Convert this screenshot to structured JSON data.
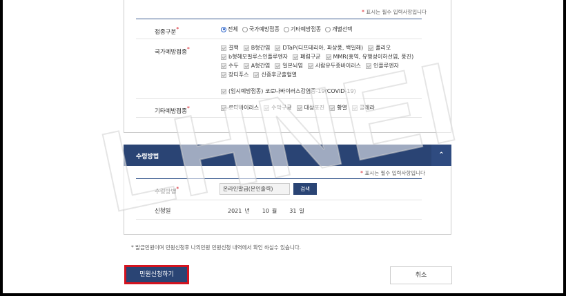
{
  "form_top": {
    "required_note": "표시는 필수 입력사항입니다",
    "vaccination_type": {
      "label": "접종구분",
      "options": [
        "전체",
        "국가예방접종",
        "기타예방접종",
        "개별선택"
      ],
      "selected": "전체"
    },
    "national": {
      "label": "국가예방접종",
      "rows": [
        [
          "결핵",
          "B형간염",
          "DTaP(디프테리아, 파상풍, 백일해)",
          "폴리오"
        ],
        [
          "b형헤모필루스인플루엔자",
          "폐렴구균",
          "MMR(홍역, 유행성이하선염, 풍진)"
        ],
        [
          "수두",
          "A형간염",
          "일본뇌염",
          "사람유두종바이러스",
          "인플루엔자"
        ],
        [
          "장티푸스",
          "신증후군출혈열"
        ]
      ],
      "covid": "(임시예방접종) 코로나바이러스감염증-19(COVID-19)"
    },
    "other": {
      "label": "기타예방접종",
      "items": [
        "로타바이러스",
        "수막구균",
        "대상포진",
        "황열",
        "콜레라"
      ]
    }
  },
  "receive_section": {
    "title": "수령방법",
    "required_note": "표시는 필수 입력사항입니다",
    "method_label": "수령방법",
    "method_value": "온라인발급(본인출력)",
    "search_label": "검색",
    "date_label": "신청일",
    "date_year": "2021",
    "year_unit": "년",
    "date_month": "10",
    "month_unit": "월",
    "date_day": "31",
    "day_unit": "일"
  },
  "footer_note": "* 발급민원이며 민원신청후 나의민원 민원신청 내역에서 확인 하실수 있습니다.",
  "buttons": {
    "submit": "민원신청하기",
    "cancel": "취소"
  },
  "watermark_text": "LHNEI",
  "colors": {
    "navy": "#2a4474",
    "required": "#d9232d",
    "highlight": "#d4131f"
  }
}
